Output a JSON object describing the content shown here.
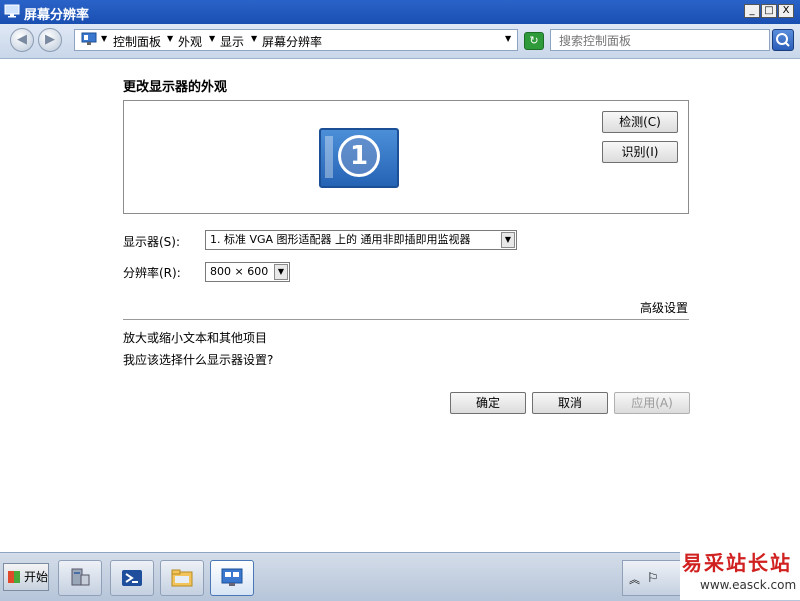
{
  "window": {
    "title": "屏幕分辨率",
    "controls": {
      "minimize": "_",
      "maximize": "□",
      "close": "X"
    }
  },
  "addressbar": {
    "back_icon": "left-arrow",
    "forward_icon": "right-arrow",
    "breadcrumb": [
      "控制面板",
      "外观",
      "显示",
      "屏幕分辨率"
    ],
    "search_placeholder": "搜索控制面板"
  },
  "main": {
    "heading": "更改显示器的外观",
    "monitor_number": "1",
    "detect_button": "检测(C)",
    "identify_button": "识别(I)",
    "display_label": "显示器(S):",
    "display_value": "1. 标准 VGA 图形适配器 上的 通用非即插即用监视器",
    "resolution_label": "分辨率(R):",
    "resolution_value": "800 × 600",
    "advanced_link": "高级设置",
    "links": [
      "放大或缩小文本和其他项目",
      "我应该选择什么显示器设置?"
    ],
    "ok_button": "确定",
    "cancel_button": "取消",
    "apply_button": "应用(A)"
  },
  "taskbar": {
    "start_label": "开始",
    "tray_chevron": "︽"
  },
  "watermark": {
    "line1": "易采站长站",
    "line2": "www.easck.com"
  },
  "colors": {
    "titlebar": "#1a4fb2",
    "accent": "#2a63c8",
    "taskbar": "#b6c5d9"
  }
}
